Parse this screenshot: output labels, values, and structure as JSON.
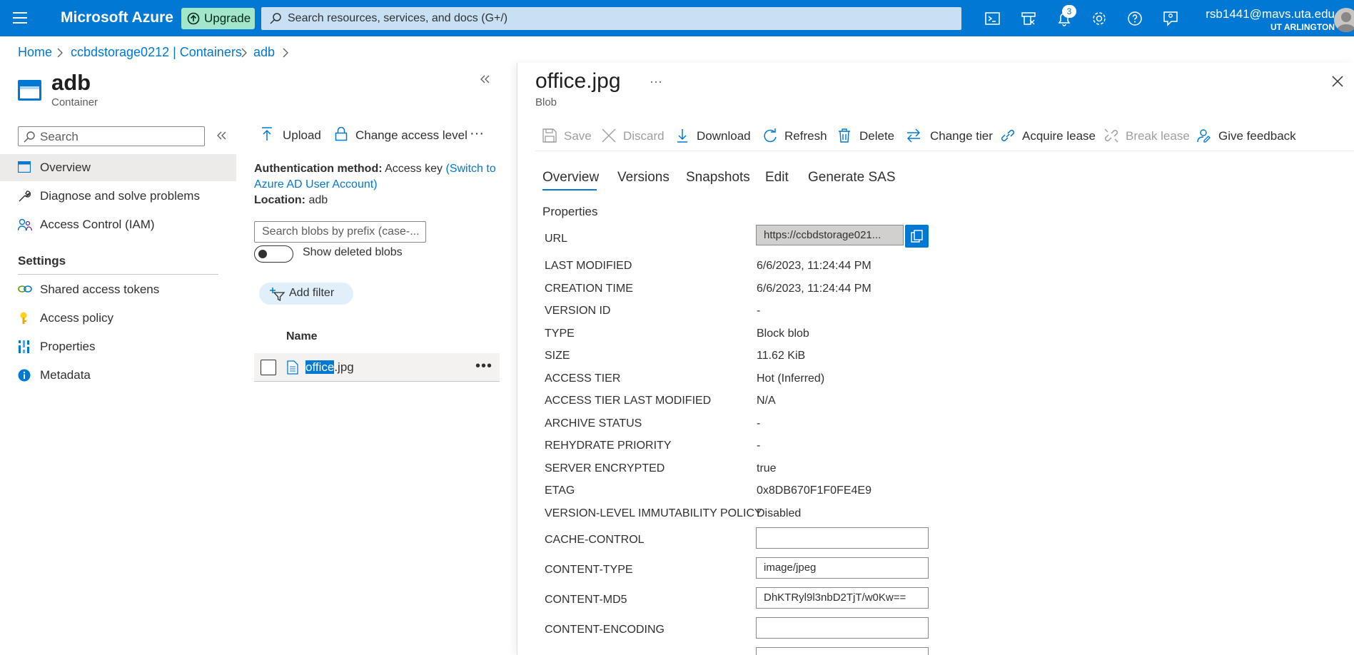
{
  "topbar": {
    "brand": "Microsoft Azure",
    "upgrade_label": "Upgrade",
    "search_placeholder": "Search resources, services, and docs (G+/)",
    "notifications_count": "3",
    "user_email": "rsb1441@mavs.uta.edu",
    "user_org": "UT ARLINGTON",
    "accent": "#0078d4"
  },
  "breadcrumb": [
    "Home",
    "ccbdstorage0212 | Containers",
    "adb"
  ],
  "container": {
    "title": "adb",
    "subtitle": "Container"
  },
  "nav": {
    "search_placeholder": "Search",
    "items": [
      {
        "label": "Overview",
        "icon": "overview-icon"
      },
      {
        "label": "Diagnose and solve problems",
        "icon": "wrench-icon"
      },
      {
        "label": "Access Control (IAM)",
        "icon": "people-icon"
      }
    ],
    "settings_header": "Settings",
    "settings_items": [
      {
        "label": "Shared access tokens",
        "icon": "link-icon"
      },
      {
        "label": "Access policy",
        "icon": "key-icon"
      },
      {
        "label": "Properties",
        "icon": "properties-icon"
      },
      {
        "label": "Metadata",
        "icon": "info-icon"
      }
    ]
  },
  "blob_list": {
    "toolbar": {
      "upload": "Upload",
      "change_access": "Change access level",
      "more": "···"
    },
    "auth_label": "Authentication method:",
    "auth_value": "Access key",
    "auth_link": "(Switch to Azure AD User Account)",
    "location_label": "Location:",
    "location_value": "adb",
    "search_placeholder": "Search blobs by prefix (case-...",
    "show_deleted": "Show deleted blobs",
    "add_filter": "Add filter",
    "column_name": "Name",
    "files": [
      {
        "name_highlight": "office",
        "name_rest": ".jpg"
      }
    ]
  },
  "blob": {
    "title": "office.jpg",
    "subtitle": "Blob",
    "ellipsis": "···",
    "toolbar": {
      "save": "Save",
      "discard": "Discard",
      "download": "Download",
      "refresh": "Refresh",
      "delete": "Delete",
      "change_tier": "Change tier",
      "acquire_lease": "Acquire lease",
      "break_lease": "Break lease",
      "feedback": "Give feedback"
    },
    "tabs": [
      "Overview",
      "Versions",
      "Snapshots",
      "Edit",
      "Generate SAS"
    ],
    "properties_header": "Properties",
    "url_label": "URL",
    "url_value": "https://ccbdstorage021...",
    "props": [
      {
        "label": "LAST MODIFIED",
        "value": "6/6/2023, 11:24:44 PM"
      },
      {
        "label": "CREATION TIME",
        "value": "6/6/2023, 11:24:44 PM"
      },
      {
        "label": "VERSION ID",
        "value": "-"
      },
      {
        "label": "TYPE",
        "value": "Block blob"
      },
      {
        "label": "SIZE",
        "value": "11.62 KiB"
      },
      {
        "label": "ACCESS TIER",
        "value": "Hot (Inferred)"
      },
      {
        "label": "ACCESS TIER LAST MODIFIED",
        "value": "N/A"
      },
      {
        "label": "ARCHIVE STATUS",
        "value": "-"
      },
      {
        "label": "REHYDRATE PRIORITY",
        "value": "-"
      },
      {
        "label": "SERVER ENCRYPTED",
        "value": "true"
      },
      {
        "label": "ETAG",
        "value": "0x8DB670F1F0FE4E9"
      },
      {
        "label": "VERSION-LEVEL IMMUTABILITY POLICY",
        "value": "Disabled"
      }
    ],
    "inputs": [
      {
        "label": "CACHE-CONTROL",
        "value": ""
      },
      {
        "label": "CONTENT-TYPE",
        "value": "image/jpeg"
      },
      {
        "label": "CONTENT-MD5",
        "value": "DhKTRyl9l3nbD2TjT/w0Kw=="
      },
      {
        "label": "CONTENT-ENCODING",
        "value": ""
      }
    ]
  }
}
